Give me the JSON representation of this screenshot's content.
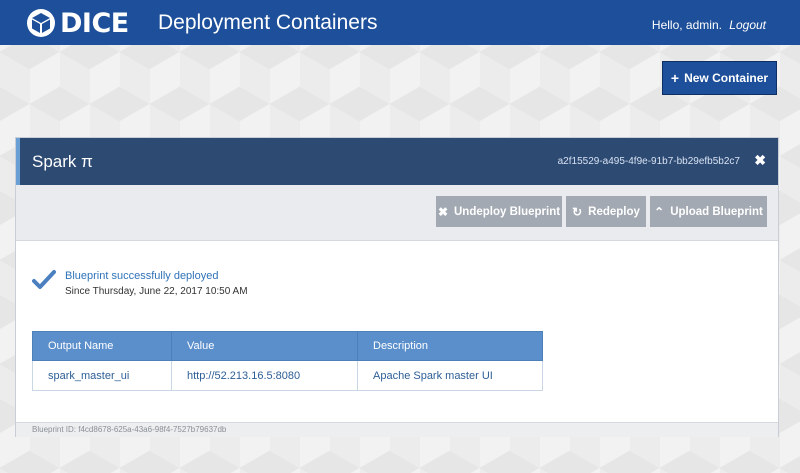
{
  "header": {
    "logo_text": "DICE",
    "title": "Deployment Containers",
    "greeting": "Hello, admin.",
    "logout_label": "Logout",
    "brand_color": "#1d4f9a"
  },
  "actions": {
    "new_container_label": "New Container"
  },
  "panel": {
    "title": "Spark π",
    "container_id": "a2f15529-a495-4f9e-91b7-bb29efb5b2c7",
    "toolbar": {
      "undeploy_label": "Undeploy Blueprint",
      "redeploy_label": "Redeploy",
      "upload_label": "Upload Blueprint"
    },
    "status": {
      "message": "Blueprint successfully deployed",
      "since": "Since Thursday, June 22, 2017 10:50 AM"
    },
    "outputs": {
      "headers": [
        "Output Name",
        "Value",
        "Description"
      ],
      "rows": [
        [
          "spark_master_ui",
          "http://52.213.16.5:8080",
          "Apache Spark master UI"
        ]
      ]
    },
    "footer": "Blueprint ID: f4cd8678-625a-43a6-98f4-7527b79637db"
  },
  "icons": {
    "logo": "cube-icon",
    "new_container": "plus-icon",
    "close": "close-icon",
    "undeploy": "times-icon",
    "redeploy": "refresh-icon",
    "upload": "chevron-up-icon",
    "status": "checkmark-icon"
  }
}
